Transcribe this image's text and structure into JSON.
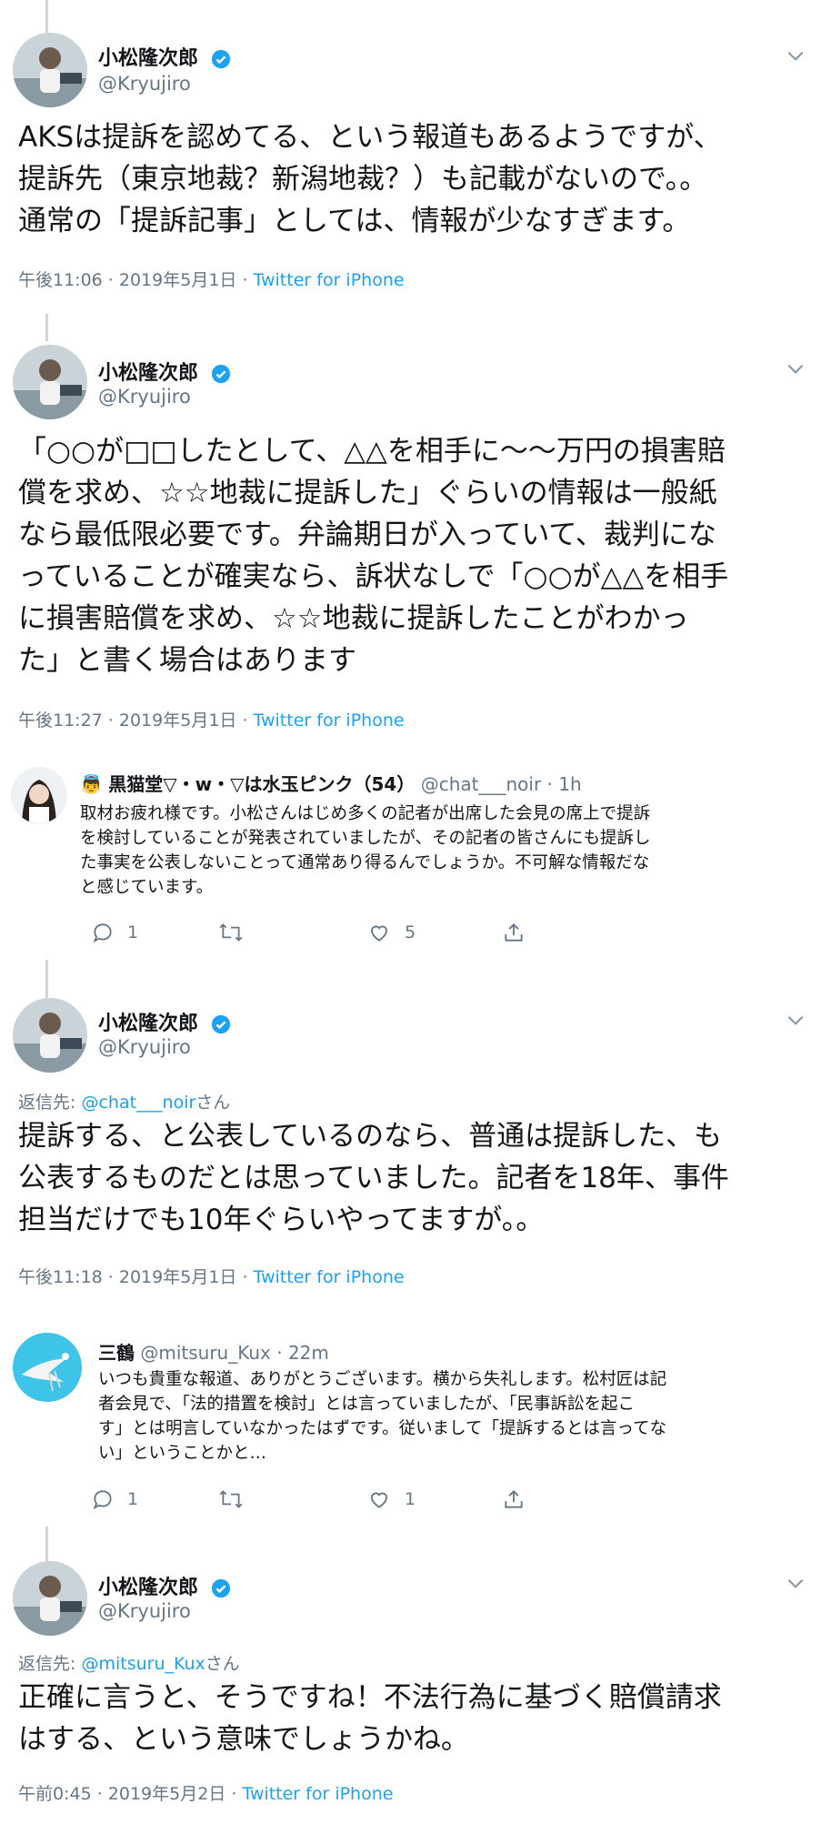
{
  "tweets": [
    {
      "name": "小松隆次郎",
      "handle": "@Kryujiro",
      "text": "AKSは提訴を認めてる、という報道もあるようですが、\n提訴先（東京地裁？新潟地裁？）も記載がないので。。\n通常の「提訴記事」としては、情報が少なすぎます。",
      "time": "午後11:06 · 2019年5月1日 · ",
      "source": "Twitter for iPhone"
    },
    {
      "name": "小松隆次郎",
      "handle": "@Kryujiro",
      "text": "「○○が□□したとして、△△を相手に〜〜万円の損害賠\n償を求め、☆☆地裁に提訴した」ぐらいの情報は一般紙\nなら最低限必要です。弁論期日が入っていて、裁判にな\nっていることが確実なら、訴状なしで「○○が△△を相手\nに損害賠償を求め、☆☆地裁に提訴したことがわかっ\nた」と書く場合はあります",
      "time": "午後11:27 · 2019年5月1日 · ",
      "source": "Twitter for iPhone"
    },
    {
      "name": "小松隆次郎",
      "handle": "@Kryujiro",
      "reply_prefix": "返信先: ",
      "reply_to": "@chat___noir",
      "reply_suffix": "さん",
      "text": "提訴する、と公表しているのなら、普通は提訴した、も\n公表するものだとは思っていました。記者を18年、事件\n担当だけでも10年ぐらいやってますが。。",
      "time": "午後11:18 · 2019年5月1日 · ",
      "source": "Twitter for iPhone"
    },
    {
      "name": "小松隆次郎",
      "handle": "@Kryujiro",
      "reply_prefix": "返信先: ",
      "reply_to": "@mitsuru_Kux",
      "reply_suffix": "さん",
      "text": "正確に言うと、そうですね！不法行為に基づく賠償請求\nはする、という意味でしょうかね。",
      "time": "午前0:45 · 2019年5月2日 · ",
      "source": "Twitter for iPhone"
    }
  ],
  "replies": [
    {
      "emoji": "👼",
      "name": "黒猫堂▽・w・▽は水玉ピンク（54）",
      "handle": "@chat___noir · 1h",
      "text": "取材お疲れ様です。小松さんはじめ多くの記者が出席した会見の席上で提訴\nを検討していることが発表されていましたが、その記者の皆さんにも提訴し\nた事実を公表しないことって通常あり得るんでしょうか。不可解な情報だな\nと感じています。",
      "reply_count": "1",
      "retweet_count": "",
      "like_count": "5"
    },
    {
      "emoji": "",
      "name": "三鶴",
      "handle": "@mitsuru_Kux · 22m",
      "text": "いつも貴重な報道、ありがとうございます。横から失礼します。松村匠は記\n者会見で、「法的措置を検討」とは言っていましたが、「民事訴訟を起こ\nす」とは明言していなかったはずです。従いまして「提訴するとは言ってな\nい」ということかと…",
      "reply_count": "1",
      "retweet_count": "",
      "like_count": "1"
    }
  ],
  "colors": {
    "accent": "#1da1f2",
    "muted": "#657786",
    "text": "#14171a"
  }
}
